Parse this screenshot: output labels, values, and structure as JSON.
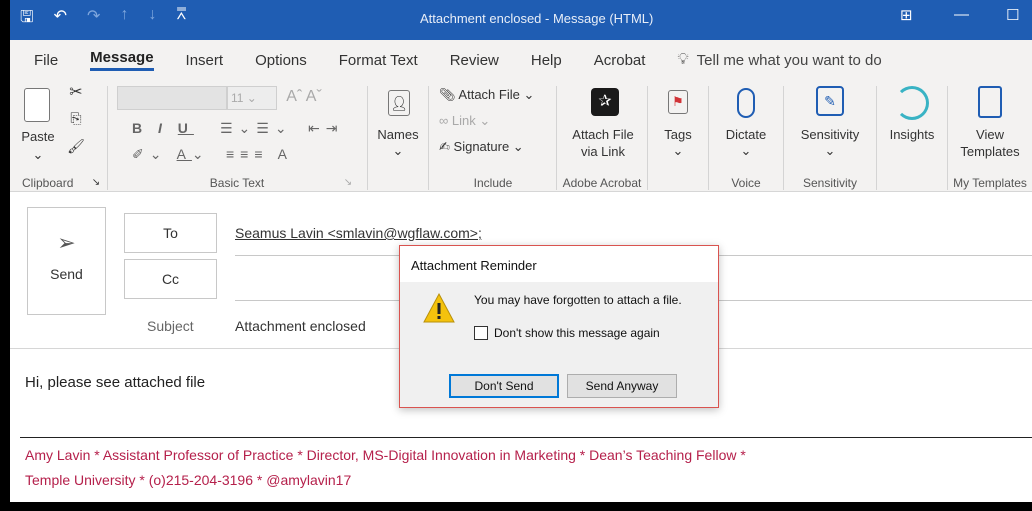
{
  "window": {
    "title": "Attachment enclosed  -  Message (HTML)"
  },
  "menu": {
    "items": [
      "File",
      "Message",
      "Insert",
      "Options",
      "Format Text",
      "Review",
      "Help",
      "Acrobat"
    ],
    "search_placeholder": "Tell me what you want to do"
  },
  "ribbon": {
    "clipboard": {
      "paste": "Paste",
      "group": "Clipboard"
    },
    "basic_text": {
      "font_size": "11",
      "group": "Basic Text"
    },
    "names": {
      "label": "Names"
    },
    "include": {
      "attach_file": "Attach File",
      "link": "Link",
      "signature": "Signature",
      "group": "Include"
    },
    "acrobat": {
      "label_line1": "Attach File",
      "label_line2": "via Link",
      "group": "Adobe Acrobat"
    },
    "tags": {
      "label": "Tags"
    },
    "voice": {
      "label": "Dictate",
      "group": "Voice"
    },
    "sensitivity": {
      "label": "Sensitivity",
      "group": "Sensitivity"
    },
    "insights": {
      "label": "Insights"
    },
    "templates": {
      "label_line1": "View",
      "label_line2": "Templates",
      "group": "My Templates"
    }
  },
  "compose": {
    "send_label": "Send",
    "to_label": "To",
    "cc_label": "Cc",
    "to_value": "Seamus Lavin <smlavin@wgflaw.com>;",
    "subject_label": "Subject",
    "subject_value": "Attachment enclosed",
    "body": "Hi, please see attached file",
    "signature_line1": "Amy Lavin * Assistant Professor of Practice * Director, MS-Digital Innovation in Marketing * Dean’s Teaching Fellow *",
    "signature_line2": "Temple University * (o)215-204-3196 * @amylavin17"
  },
  "dialog": {
    "title": "Attachment Reminder",
    "message": "You may have forgotten to attach a file.",
    "checkbox_label": "Don't show this message again",
    "dont_send": "Don't Send",
    "send_anyway": "Send Anyway"
  },
  "colors": {
    "titlebar": "#1f5db3",
    "signature": "#b5204b",
    "dialog_border": "#d9534f"
  }
}
